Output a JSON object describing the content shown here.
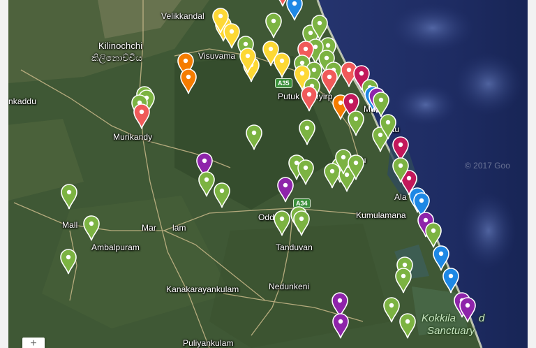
{
  "map": {
    "places": {
      "velikkandal": "Velikkandal",
      "kilinochchi": "Kilinochchi",
      "kilinochchi_tamil": "කිලිනොච්චිය",
      "visuvama": "Visuvama",
      "kaddu": "nkaddu",
      "putuk": "Putuk",
      "iyirp": "iyirp",
      "murikandy": "Murikandy",
      "mu": "Mu",
      "tu": "tu",
      "yuttu": "yuttu",
      "alam": "Ala",
      "kumulamana": "Kumulamana",
      "mallavi": "Mall",
      "mankulam_left": "Mar",
      "mankulam_right": "lam",
      "oddusuddan": "Odd",
      "tanduvan": "Tanduvan",
      "ambalpuram": "Ambalpuram",
      "nedunkeni": "Nedunkeni",
      "kanakarayankulam": "Kanakarayankulam",
      "kokkilai": "Kokkila",
      "kokkilai_tail": "d",
      "sanctuary": "Sanctuary",
      "puliyankulam": "Puliyankulam"
    },
    "road_shields": {
      "a35": "A35",
      "a34": "A34"
    },
    "watermark": "© 2017 Goo",
    "zoom_in_label": "+"
  },
  "marker_colors": {
    "green": "#7cb342",
    "yellow": "#fdd835",
    "orange": "#f57c00",
    "red": "#f05a5a",
    "magenta": "#c2185b",
    "purple": "#8e24aa",
    "blue": "#1e88e5"
  },
  "markers": [
    {
      "color": "red"
    },
    {
      "color": "blue"
    },
    {
      "color": "green"
    },
    {
      "color": "yellow"
    },
    {
      "color": "yellow"
    },
    {
      "color": "yellow"
    },
    {
      "color": "green"
    },
    {
      "color": "green"
    },
    {
      "color": "green"
    },
    {
      "color": "green"
    },
    {
      "color": "green"
    },
    {
      "color": "red"
    },
    {
      "color": "yellow"
    },
    {
      "color": "yellow"
    },
    {
      "color": "green"
    },
    {
      "color": "orange"
    },
    {
      "color": "orange"
    },
    {
      "color": "yellow"
    },
    {
      "color": "yellow"
    },
    {
      "color": "green"
    },
    {
      "color": "green"
    },
    {
      "color": "green"
    },
    {
      "color": "red"
    },
    {
      "color": "red"
    },
    {
      "color": "magenta"
    },
    {
      "color": "green"
    },
    {
      "color": "yellow"
    },
    {
      "color": "green"
    },
    {
      "color": "red"
    },
    {
      "color": "orange"
    },
    {
      "color": "magenta"
    },
    {
      "color": "blue"
    },
    {
      "color": "purple"
    },
    {
      "color": "green"
    },
    {
      "color": "green"
    },
    {
      "color": "green"
    },
    {
      "color": "green"
    },
    {
      "color": "red"
    },
    {
      "color": "green"
    },
    {
      "color": "green"
    },
    {
      "color": "green"
    },
    {
      "color": "green"
    },
    {
      "color": "green"
    },
    {
      "color": "magenta"
    },
    {
      "color": "purple"
    },
    {
      "color": "green"
    },
    {
      "color": "green"
    },
    {
      "color": "green"
    },
    {
      "color": "green"
    },
    {
      "color": "green"
    },
    {
      "color": "green"
    },
    {
      "color": "green"
    },
    {
      "color": "purple"
    },
    {
      "color": "green"
    },
    {
      "color": "green"
    },
    {
      "color": "magenta"
    },
    {
      "color": "green"
    },
    {
      "color": "green"
    },
    {
      "color": "green"
    },
    {
      "color": "green"
    },
    {
      "color": "blue"
    },
    {
      "color": "blue"
    },
    {
      "color": "purple"
    },
    {
      "color": "green"
    },
    {
      "color": "blue"
    },
    {
      "color": "green"
    },
    {
      "color": "green"
    },
    {
      "color": "blue"
    },
    {
      "color": "purple"
    },
    {
      "color": "purple"
    },
    {
      "color": "purple"
    },
    {
      "color": "purple"
    },
    {
      "color": "green"
    },
    {
      "color": "green"
    },
    {
      "color": "green"
    },
    {
      "color": "green"
    },
    {
      "color": "green"
    }
  ]
}
